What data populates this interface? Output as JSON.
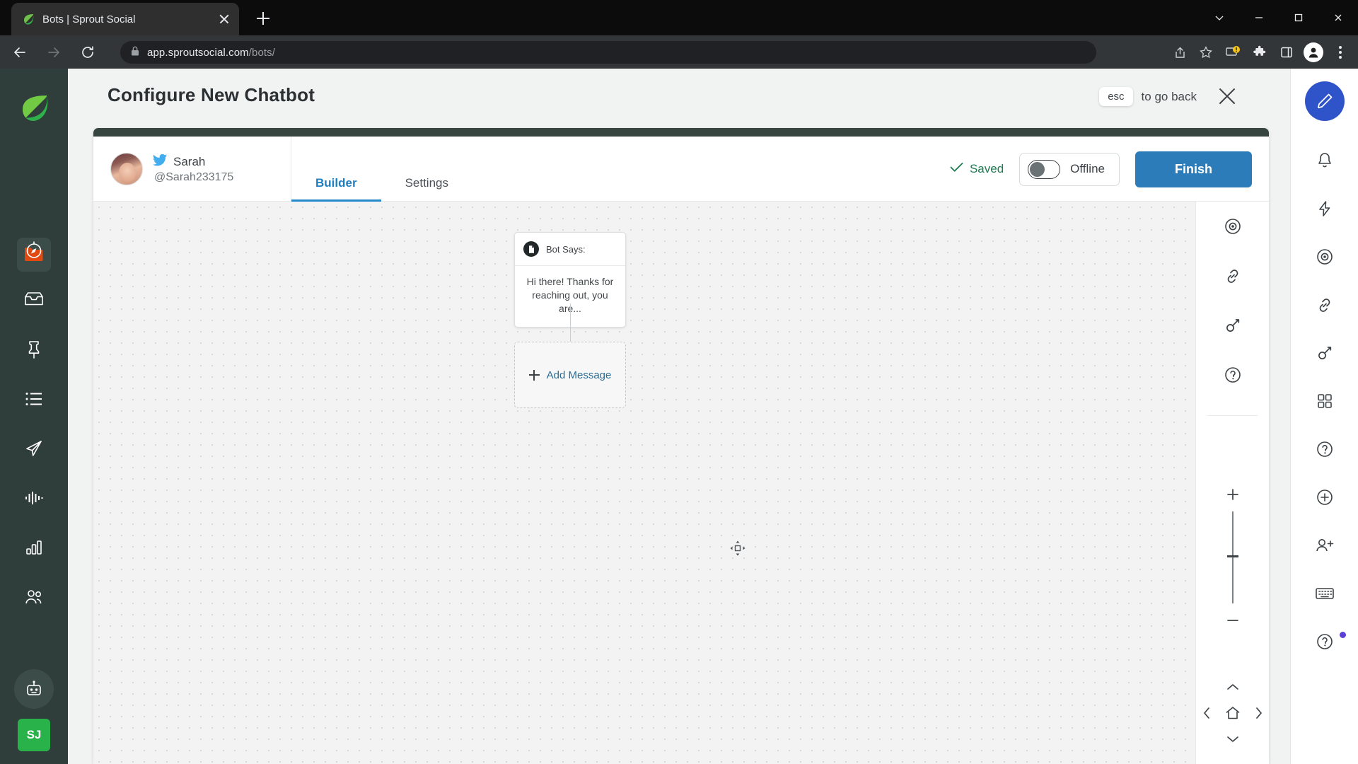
{
  "browser": {
    "tab": {
      "title": "Bots | Sprout Social",
      "favicon_icon": "sprout-leaf-icon",
      "close_icon": "close-icon"
    },
    "new_tab_icon": "plus-icon",
    "window_controls": [
      {
        "name": "chevron-down-icon",
        "label": ""
      },
      {
        "name": "minimize-icon",
        "label": ""
      },
      {
        "name": "maximize-icon",
        "label": ""
      },
      {
        "name": "window-close-icon",
        "label": ""
      }
    ],
    "nav": {
      "back_icon": "back-arrow-icon",
      "forward_icon": "forward-arrow-icon",
      "reload_icon": "reload-icon"
    },
    "omnibox": {
      "lock_icon": "lock-icon",
      "url_host": "app.sproutsocial.com",
      "url_path": "/bots/"
    },
    "toolbar_icons": [
      "share-icon",
      "bookmark-star-icon",
      "update-alert-icon",
      "extensions-puzzle-icon",
      "side-panel-icon",
      "profile-avatar-icon",
      "browser-menu-icon"
    ]
  },
  "left_rail": {
    "logo_icon": "sprout-leaf-logo",
    "items": [
      {
        "name": "sidebar-item-folder",
        "icon": "folder-icon",
        "active": true
      },
      {
        "name": "sidebar-item-dashboard",
        "icon": "compass-icon",
        "active": false
      },
      {
        "name": "sidebar-item-inbox",
        "icon": "inbox-icon",
        "active": false
      },
      {
        "name": "sidebar-item-pinned",
        "icon": "pin-icon",
        "active": false
      },
      {
        "name": "sidebar-item-feeds",
        "icon": "list-icon",
        "active": false
      },
      {
        "name": "sidebar-item-publishing",
        "icon": "paper-plane-icon",
        "active": false
      },
      {
        "name": "sidebar-item-listening",
        "icon": "waveform-icon",
        "active": false
      },
      {
        "name": "sidebar-item-reports",
        "icon": "bar-chart-icon",
        "active": false
      },
      {
        "name": "sidebar-item-audience",
        "icon": "people-icon",
        "active": false
      }
    ],
    "bot_icon": "robot-icon",
    "user_initials": "SJ"
  },
  "header": {
    "title": "Configure New Chatbot",
    "esc_key": "esc",
    "esc_text": "to go back",
    "close_icon": "close-icon"
  },
  "builder": {
    "profile": {
      "network_icon": "twitter-icon",
      "name": "Sarah",
      "handle": "@Sarah233175",
      "avatar": "user-avatar"
    },
    "tabs": [
      {
        "label": "Builder",
        "active": true
      },
      {
        "label": "Settings",
        "active": false
      }
    ],
    "saved_label": "Saved",
    "saved_icon": "check-icon",
    "toggle": {
      "label": "Offline",
      "state": "off"
    },
    "finish_label": "Finish",
    "accent_blue": "#2b7cb9",
    "accent_green": "#1e7b52",
    "card_bar_color": "#36453f"
  },
  "canvas": {
    "bot_node": {
      "icon": "document-icon",
      "header_label": "Bot Says:",
      "message": "Hi there! Thanks for reaching out, you are..."
    },
    "add_node": {
      "plus_icon": "plus-icon",
      "label": "Add Message"
    },
    "cursor_icon": "move-cursor-icon"
  },
  "canvas_tools": {
    "items": [
      {
        "name": "preview-eye-button",
        "icon": "eye-icon"
      },
      {
        "name": "link-button",
        "icon": "link-icon"
      },
      {
        "name": "key-button",
        "icon": "key-icon"
      },
      {
        "name": "help-button",
        "icon": "question-circle-icon"
      }
    ],
    "zoom_in_icon": "plus-icon",
    "zoom_out_icon": "minus-icon",
    "pan": {
      "up_icon": "chevron-up-icon",
      "down_icon": "chevron-down-icon",
      "left_icon": "chevron-left-icon",
      "right_icon": "chevron-right-icon",
      "home_icon": "home-icon"
    }
  },
  "right_rail": {
    "compose_icon": "compose-pencil-icon",
    "items": [
      {
        "name": "notifications-button",
        "icon": "bell-icon"
      },
      {
        "name": "shortcuts-button",
        "icon": "lightning-icon"
      },
      {
        "name": "monitor-button",
        "icon": "target-icon"
      },
      {
        "name": "link-button",
        "icon": "link-icon"
      },
      {
        "name": "key-button",
        "icon": "key-icon"
      },
      {
        "name": "apps-button",
        "icon": "grid-icon"
      },
      {
        "name": "help-button",
        "icon": "question-circle-icon"
      },
      {
        "name": "add-button",
        "icon": "plus-circle-icon"
      },
      {
        "name": "invite-user-button",
        "icon": "user-plus-icon"
      },
      {
        "name": "keyboard-button",
        "icon": "keyboard-icon"
      },
      {
        "name": "support-button",
        "icon": "question-circle-icon"
      }
    ]
  }
}
